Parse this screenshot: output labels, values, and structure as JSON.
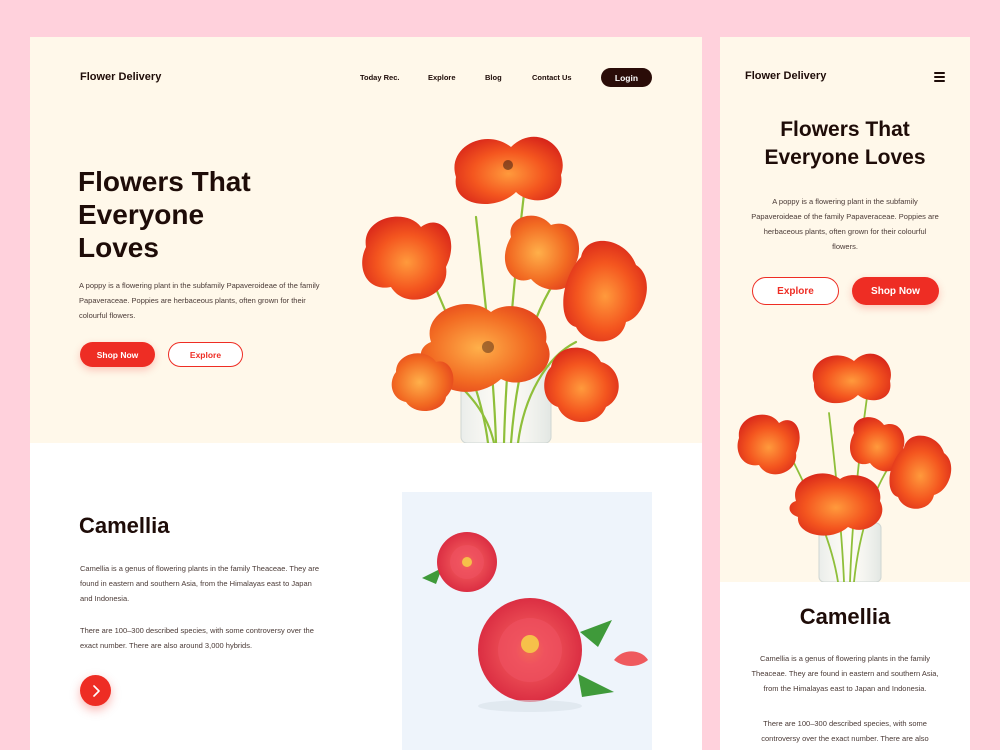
{
  "brand": "Flower Delivery",
  "nav": {
    "items": [
      "Today Rec.",
      "Explore",
      "Blog",
      "Contact Us"
    ],
    "login": "Login"
  },
  "hero": {
    "title_lines": [
      "Flowers That",
      "Everyone",
      "Loves"
    ],
    "mobile_title_lines": [
      "Flowers That",
      "Everyone Loves"
    ],
    "description": "A poppy is a flowering plant in the subfamily Papaveroideae of the family Papaveraceae. Poppies are herbaceous plants, often grown for their colourful flowers.",
    "shop_now": "Shop Now",
    "explore": "Explore"
  },
  "camellia": {
    "title": "Camellia",
    "p1": "Camellia is a genus of flowering plants in the family Theaceae. They are found in eastern and southern Asia, from the Himalayas east to Japan and Indonesia.",
    "p2": "There are 100–300 described species, with some controversy over the exact number. There are also around 3,000 hybrids.",
    "mobile_p2": "There are 100–300 described species, with some controversy over the exact number. There are also"
  },
  "icons": {
    "arrow": "chevron-right-icon",
    "menu": "hamburger-menu-icon"
  },
  "colors": {
    "accent": "#ee2d24",
    "background": "#ffd1dc",
    "hero_background": "#fff8ea",
    "dark": "#1e0c08",
    "login_bg": "#2a0c08"
  }
}
